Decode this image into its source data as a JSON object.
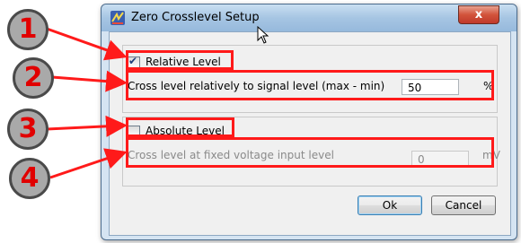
{
  "window": {
    "title": "Zero Crosslevel Setup",
    "close_glyph": "x"
  },
  "relative": {
    "label": "Relative Level",
    "checked": true,
    "field_label": "Cross level relatively to signal level (max - min)",
    "value": "50",
    "unit": "%"
  },
  "absolute": {
    "label": "Absolute Level",
    "checked": false,
    "field_label": "Cross level at fixed voltage input level",
    "value": "0",
    "unit": "mV"
  },
  "buttons": {
    "ok": "Ok",
    "cancel": "Cancel"
  },
  "annotations": {
    "badges": [
      "1",
      "2",
      "3",
      "4"
    ],
    "color": "#ff1a1a"
  }
}
